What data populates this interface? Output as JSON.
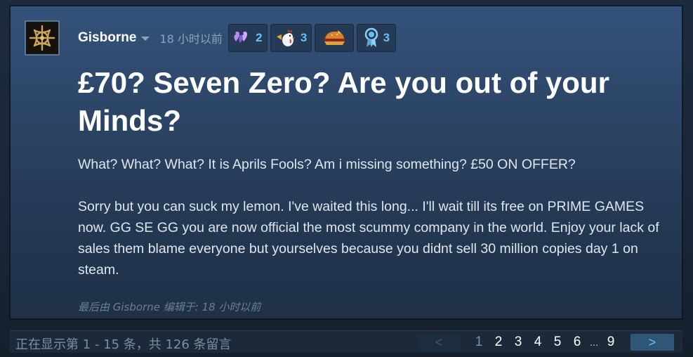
{
  "post": {
    "author": "Gisborne",
    "timestamp": "18 小时以前",
    "awards": [
      {
        "icon": "hearts-award-icon",
        "count": "2"
      },
      {
        "icon": "chicken-horn-award-icon",
        "count": "3"
      },
      {
        "icon": "burger-award-icon",
        "count": ""
      },
      {
        "icon": "ribbon-medal-award-icon",
        "count": "3"
      }
    ],
    "title": "£70? Seven Zero? Are you out of your Minds?",
    "paragraph_1": "What? What? What? It is Aprils Fools? Am i missing something? £50 ON OFFER?",
    "paragraph_2": "Sorry but you can suck my lemon. I've waited this long... I'll wait till its free on PRIME GAMES now. GG SE GG you are now official the most scummy company in the world. Enjoy your lack of sales them blame everyone but yourselves because you didnt sell 30 million copies day 1 on steam.",
    "edited_note": "最后由 Gisborne 编辑于: 18 小时以前"
  },
  "footer": {
    "showing": "正在显示第 1 - 15 条，共 126 条留言",
    "prev_label": "<",
    "next_label": ">",
    "pages": [
      "1",
      "2",
      "3",
      "4",
      "5",
      "6"
    ],
    "ellipsis": "...",
    "last_page": "9",
    "current_page": "1"
  },
  "colors": {
    "accent": "#67c1f5",
    "panel": "#2c4566",
    "text": "#dfe6ed",
    "muted": "#8fa3b8"
  }
}
